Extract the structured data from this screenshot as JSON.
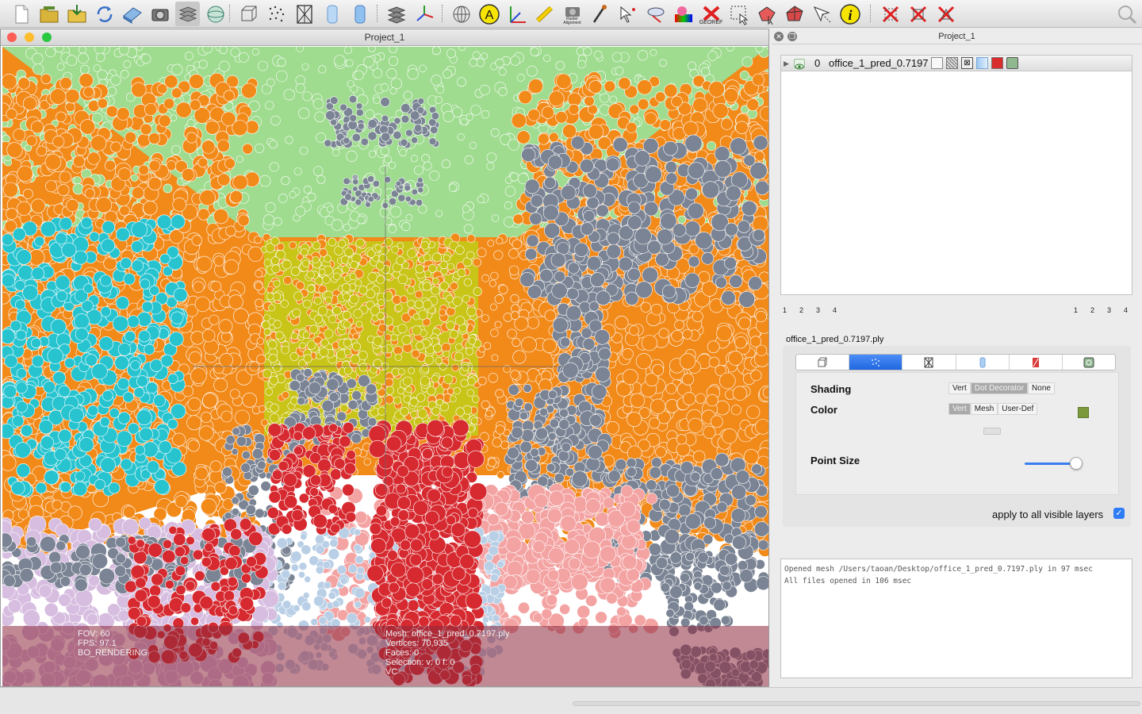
{
  "toolbar": {
    "buttons": [
      {
        "name": "new-project-icon"
      },
      {
        "name": "open-project-icon"
      },
      {
        "name": "import-mesh-icon"
      },
      {
        "name": "reload-icon"
      },
      {
        "name": "save-icon"
      },
      {
        "name": "snapshot-icon"
      },
      {
        "name": "layers-icon"
      },
      {
        "name": "radar-icon"
      },
      {
        "name": "bounding-box-icon"
      },
      {
        "name": "points-icon"
      },
      {
        "name": "wireframe-icon"
      },
      {
        "name": "flat-shading-icon"
      },
      {
        "name": "smooth-shading-icon"
      },
      {
        "name": "texture-icon"
      },
      {
        "name": "axis-icon"
      },
      {
        "name": "globe-icon"
      },
      {
        "name": "annotation-icon"
      },
      {
        "name": "trackball-icon"
      },
      {
        "name": "measure-icon"
      },
      {
        "name": "raster-alignment-icon",
        "label": "Raster\nAlignment"
      },
      {
        "name": "paint-icon"
      },
      {
        "name": "pick-points-icon"
      },
      {
        "name": "align-icon"
      },
      {
        "name": "color-paint-icon"
      },
      {
        "name": "georef-icon",
        "label": "GEOREF"
      },
      {
        "name": "select-vertices-icon"
      },
      {
        "name": "select-faces-icon"
      },
      {
        "name": "select-connected-icon"
      },
      {
        "name": "select-cursor-icon"
      },
      {
        "name": "info-icon"
      },
      {
        "name": "delete-vertices-icon"
      },
      {
        "name": "delete-faces-icon"
      },
      {
        "name": "delete-selection-icon"
      },
      {
        "name": "search-icon"
      }
    ]
  },
  "viewport": {
    "title": "Project_1",
    "hud_left": [
      "FOV: 60",
      "FPS:   97.1",
      "BO_RENDERING"
    ],
    "hud_right": [
      "Mesh: office_1_pred_0.7197.ply",
      "Vertices: 70,935",
      "Faces: 0",
      "Selection: v: 0 f: 0",
      "VC"
    ]
  },
  "right_panel": {
    "title": "Project_1",
    "layer": {
      "index": "0",
      "name": "office_1_pred_0.7197"
    },
    "numbers_left": [
      "1",
      "2",
      "3",
      "4"
    ],
    "numbers_right": [
      "1",
      "2",
      "3",
      "4"
    ],
    "filename": "office_1_pred_0.7197.ply",
    "shading_label": "Shading",
    "shading_options": [
      "Vert",
      "Dot Decorator",
      "None"
    ],
    "shading_selected": "Dot Decorator",
    "color_label": "Color",
    "color_options": [
      "Vert",
      "Mesh",
      "User-Def"
    ],
    "color_selected": "Vert",
    "user_color": "#7c9a3c",
    "point_size_label": "Point Size",
    "point_size_value": 0.9,
    "apply_label": "apply to all visible layers",
    "apply_checked": true
  },
  "log": [
    "Opened mesh /Users/taoan/Desktop/office_1_pred_0.7197.ply in 97 msec",
    "All files opened in 106 msec"
  ],
  "scene_colors": {
    "ceiling": "#9fdc8f",
    "wall": "#f28a1a",
    "back_wall": "#c8c418",
    "board": "#27c4d0",
    "clutter": "#7b8494",
    "chair": "#d62a30",
    "table": "#f4a3a3",
    "floor": "#b9cfe6",
    "sofa": "#d7bde0"
  }
}
